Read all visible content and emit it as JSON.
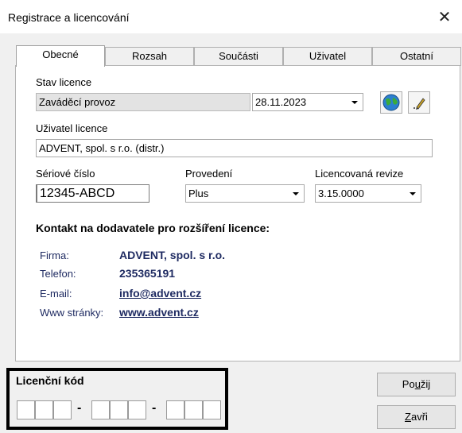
{
  "window": {
    "title": "Registrace a licencování",
    "close_glyph": "✕"
  },
  "tabs": [
    {
      "label": "Obecné",
      "active": true
    },
    {
      "label": "Rozsah",
      "active": false
    },
    {
      "label": "Součásti",
      "active": false
    },
    {
      "label": "Uživatel",
      "active": false
    },
    {
      "label": "Ostatní",
      "active": false
    }
  ],
  "stav": {
    "label": "Stav licence",
    "value": "Zaváděcí provoz",
    "date": "28.11.2023",
    "globe_icon": "globe-icon",
    "edit_icon": "pencil-icon"
  },
  "uzivatel": {
    "label": "Uživatel licence",
    "value": "ADVENT, spol. s r.o. (distr.)"
  },
  "seriove": {
    "label": "Sériové číslo",
    "value": "12345-ABCD"
  },
  "provedeni": {
    "label": "Provedení",
    "value": "Plus"
  },
  "revize": {
    "label": "Licencovaná revize",
    "value": "3.15.0000"
  },
  "kontakt": {
    "heading": "Kontakt na dodavatele pro rozšíření licence:",
    "firma_label": "Firma:",
    "firma": "ADVENT, spol. s r.o.",
    "telefon_label": "Telefon:",
    "telefon": "235365191",
    "email_label": "E-mail:",
    "email": "info@advent.cz",
    "www_label": "Www stránky:",
    "www": "www.advent.cz",
    "text_color": "#1f2b62"
  },
  "licencni_kod": {
    "title": "Licenční kód",
    "separator": "-"
  },
  "buttons": {
    "pouzij_prefix": "Po",
    "pouzij_accel": "u",
    "pouzij_suffix": "žij",
    "zavri_prefix": "",
    "zavri_accel": "Z",
    "zavri_suffix": "avři"
  }
}
